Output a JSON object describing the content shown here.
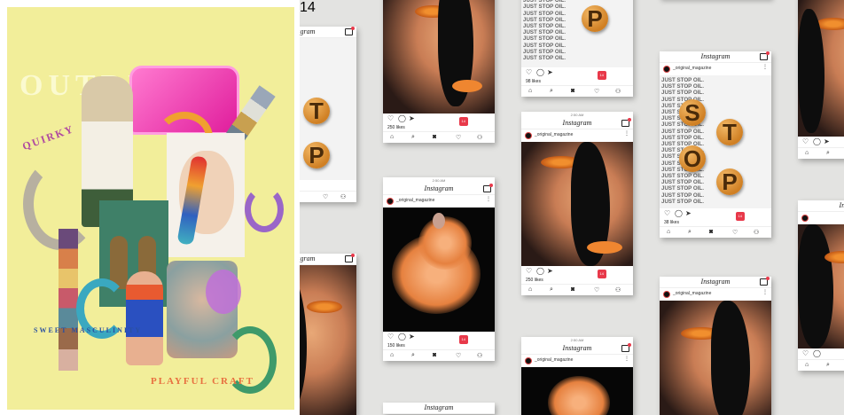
{
  "collage": {
    "title_big": "OUTRE'",
    "word_quirky": "QUIRKY",
    "word_sweet": "SWEET MASCULINITY",
    "word_playful": "PLAYFUL CRAFT",
    "colors": {
      "background": "#f2ee9a",
      "pink_chair": "#f02fb0",
      "orange_swirl": "#f0a030",
      "teal_swirl": "#3aa8c0",
      "purple_swirl": "#9a66c8",
      "green_building": "#3f8068"
    }
  },
  "instagram_mockups": {
    "app_name": "Instagram",
    "username": "_original_magazine",
    "time": "2:50 AM",
    "text_repeat": "JUST STOP OIL.",
    "letters": [
      "S",
      "T",
      "O",
      "P"
    ],
    "notification_count": "14",
    "like_counts": [
      "98 likes",
      "250 likes",
      "250 likes",
      "38 likes",
      "150 likes"
    ],
    "nav_icons": [
      "home-icon",
      "search-icon",
      "camera-icon",
      "heart-icon",
      "profile-icon"
    ],
    "action_icons": [
      "heart-icon",
      "comment-icon",
      "share-icon",
      "bookmark-icon"
    ],
    "accent_color": "#e8394a",
    "orange_color": "#ef8630"
  }
}
